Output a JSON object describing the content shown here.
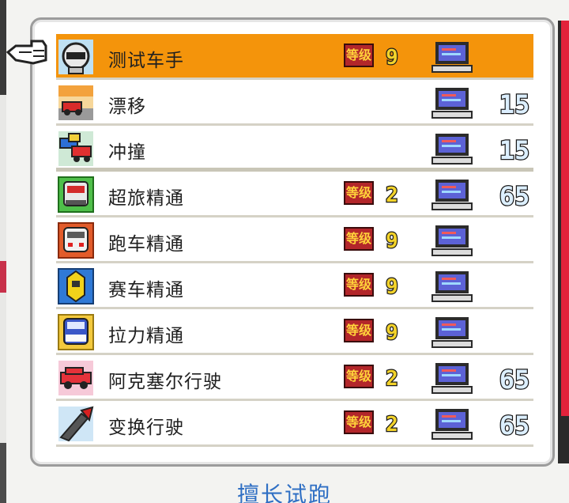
{
  "skills": [
    {
      "name": "测试车手",
      "icon": "driver-helmet-icon",
      "level": "9",
      "cost": "",
      "selected": true
    },
    {
      "name": "漂移",
      "icon": "drift-car-icon",
      "level": "",
      "cost": "15",
      "selected": false
    },
    {
      "name": "冲撞",
      "icon": "crash-cars-icon",
      "level": "",
      "cost": "15",
      "selected": false
    },
    {
      "name": "超旅精通",
      "icon": "touring-car-icon",
      "level": "2",
      "cost": "65",
      "selected": false
    },
    {
      "name": "跑车精通",
      "icon": "sports-car-icon",
      "level": "9",
      "cost": "",
      "selected": false
    },
    {
      "name": "赛车精通",
      "icon": "race-car-icon",
      "level": "9",
      "cost": "",
      "selected": false
    },
    {
      "name": "拉力精通",
      "icon": "rally-car-icon",
      "level": "9",
      "cost": "",
      "selected": false
    },
    {
      "name": "阿克塞尔行驶",
      "icon": "axel-drive-car-icon",
      "level": "2",
      "cost": "65",
      "selected": false
    },
    {
      "name": "变换行驶",
      "icon": "transform-drive-icon",
      "level": "2",
      "cost": "65",
      "selected": false
    }
  ],
  "level_tag": "等级",
  "footer_title": "擅长试跑",
  "colors": {
    "selected_row": "#f4940b",
    "footer_text": "#2f6fc4",
    "scroll_thumb": "#e2223b"
  }
}
